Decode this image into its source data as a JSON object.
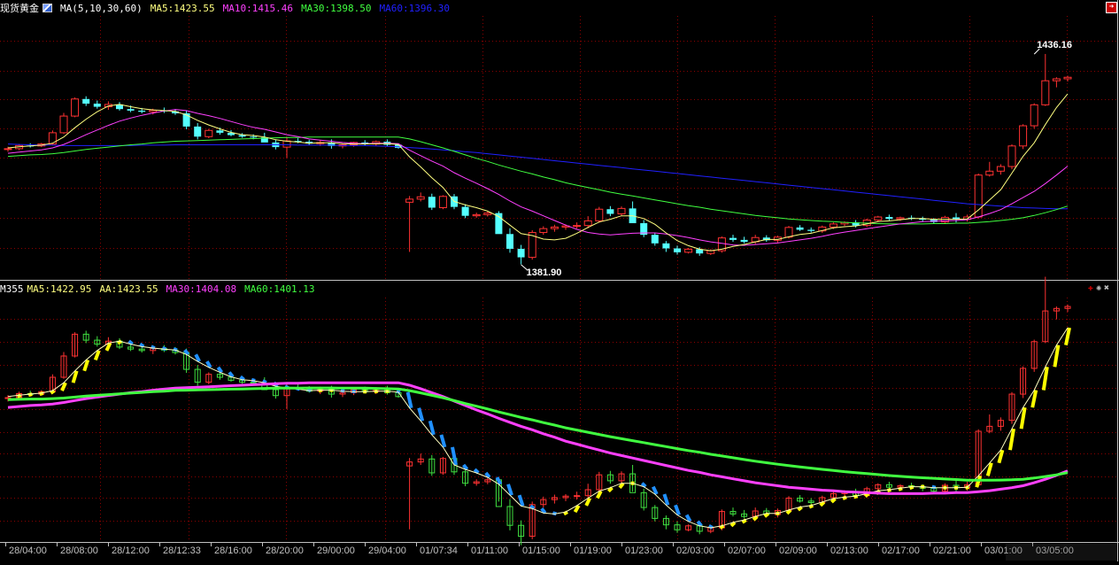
{
  "header_main": {
    "symbol": "现货黄金",
    "ma_label": "MA(5,10,30,60)",
    "ma5": "MA5:1423.55",
    "ma10": "MA10:1415.46",
    "ma30": "MA30:1398.50",
    "ma60": "MA60:1396.30"
  },
  "header_sub": {
    "name": "M355",
    "ma5": "MA5:1422.95",
    "aa": "AA:1423.55",
    "ma30": "MA30:1404.08",
    "ma60": "MA60:1401.13"
  },
  "colors": {
    "background": "#000000",
    "up": "#ff3232",
    "down": "#54ffff",
    "ma5": "#ffff80",
    "ma10": "#ff40ff",
    "ma30": "#40ff40",
    "ma60": "#2020ff",
    "grid": "#8b0000",
    "axis_text": "#c0c0c0",
    "sub_up": "#ff3232",
    "sub_down": "#40e040",
    "sub_bar": "#ffff00",
    "sub_bar_down": "#2090ff",
    "sub_ma30": "#ff40ff",
    "sub_ma60": "#40ff40"
  },
  "chart_data": [
    {
      "type": "candlestick",
      "panel": "main",
      "y_range": [
        1378,
        1446
      ],
      "annotations": [
        {
          "text": "1436.16",
          "candle": 92,
          "value": 1436.16,
          "kind": "high"
        },
        {
          "text": "1381.90",
          "candle": 46,
          "value": 1381.9,
          "kind": "low"
        }
      ],
      "ohlc": [
        [
          1411.6,
          1412.3,
          1411.0,
          1411.8
        ],
        [
          1411.8,
          1413.0,
          1411.4,
          1412.6
        ],
        [
          1412.6,
          1413.2,
          1412.1,
          1412.5
        ],
        [
          1412.5,
          1413.3,
          1412.2,
          1413.0
        ],
        [
          1413.0,
          1416.5,
          1412.7,
          1415.9
        ],
        [
          1415.9,
          1421.0,
          1415.6,
          1420.2
        ],
        [
          1420.2,
          1425.0,
          1419.9,
          1424.6
        ],
        [
          1424.6,
          1425.3,
          1422.8,
          1423.4
        ],
        [
          1423.4,
          1424.2,
          1422.1,
          1422.6
        ],
        [
          1422.6,
          1424.0,
          1421.8,
          1423.2
        ],
        [
          1423.2,
          1423.8,
          1421.6,
          1422.0
        ],
        [
          1422.0,
          1422.9,
          1421.2,
          1421.6
        ],
        [
          1421.6,
          1422.3,
          1420.9,
          1421.3
        ],
        [
          1421.3,
          1422.1,
          1420.6,
          1421.7
        ],
        [
          1421.7,
          1422.4,
          1421.0,
          1421.4
        ],
        [
          1421.4,
          1422.0,
          1420.5,
          1420.9
        ],
        [
          1420.9,
          1421.7,
          1416.8,
          1417.5
        ],
        [
          1417.5,
          1418.4,
          1414.2,
          1414.9
        ],
        [
          1414.9,
          1416.9,
          1414.5,
          1416.5
        ],
        [
          1416.5,
          1417.2,
          1415.4,
          1415.9
        ],
        [
          1415.9,
          1416.6,
          1415.0,
          1415.3
        ],
        [
          1415.3,
          1415.8,
          1414.6,
          1414.9
        ],
        [
          1414.9,
          1415.5,
          1414.2,
          1414.7
        ],
        [
          1414.7,
          1415.9,
          1414.3,
          1413.4
        ],
        [
          1413.4,
          1414.2,
          1411.6,
          1412.2
        ],
        [
          1412.2,
          1414.6,
          1409.5,
          1413.8
        ],
        [
          1413.8,
          1414.5,
          1413.2,
          1413.6
        ],
        [
          1413.6,
          1414.1,
          1412.8,
          1413.1
        ],
        [
          1413.1,
          1414.0,
          1412.5,
          1413.4
        ],
        [
          1413.4,
          1414.2,
          1411.8,
          1412.5
        ],
        [
          1412.5,
          1413.1,
          1411.9,
          1412.8
        ],
        [
          1412.8,
          1413.6,
          1412.3,
          1413.4
        ],
        [
          1413.4,
          1414.0,
          1412.6,
          1413.0
        ],
        [
          1413.0,
          1413.9,
          1412.5,
          1413.6
        ],
        [
          1413.6,
          1414.2,
          1412.4,
          1412.8
        ],
        [
          1412.8,
          1413.0,
          1411.8,
          1412.0
        ],
        [
          1398.0,
          1399.6,
          1385.2,
          1398.8
        ],
        [
          1398.8,
          1400.5,
          1398.2,
          1399.4
        ],
        [
          1399.4,
          1400.2,
          1396.0,
          1396.6
        ],
        [
          1396.6,
          1399.8,
          1396.2,
          1399.5
        ],
        [
          1399.5,
          1400.1,
          1396.2,
          1396.8
        ],
        [
          1396.8,
          1397.5,
          1393.9,
          1394.5
        ],
        [
          1394.5,
          1395.3,
          1394.0,
          1394.8
        ],
        [
          1394.8,
          1395.6,
          1394.3,
          1395.2
        ],
        [
          1395.2,
          1395.7,
          1390.8,
          1389.8
        ],
        [
          1389.8,
          1391.3,
          1385.0,
          1386.0
        ],
        [
          1386.0,
          1387.0,
          1382.0,
          1383.8
        ],
        [
          1383.8,
          1390.8,
          1383.2,
          1390.2
        ],
        [
          1390.2,
          1391.8,
          1389.6,
          1391.2
        ],
        [
          1391.2,
          1392.2,
          1390.4,
          1391.6
        ],
        [
          1391.6,
          1392.3,
          1390.9,
          1391.9
        ],
        [
          1391.9,
          1392.8,
          1391.2,
          1392.0
        ],
        [
          1392.0,
          1394.4,
          1391.3,
          1393.2
        ],
        [
          1393.2,
          1396.8,
          1392.7,
          1396.2
        ],
        [
          1396.2,
          1397.0,
          1394.4,
          1395.0
        ],
        [
          1395.0,
          1396.9,
          1394.5,
          1396.4
        ],
        [
          1396.4,
          1398.2,
          1392.8,
          1392.6
        ],
        [
          1392.6,
          1393.4,
          1389.0,
          1389.6
        ],
        [
          1389.6,
          1390.1,
          1386.8,
          1387.4
        ],
        [
          1387.4,
          1388.0,
          1385.2,
          1386.1
        ],
        [
          1386.1,
          1386.8,
          1384.5,
          1385.1
        ],
        [
          1385.1,
          1386.2,
          1384.8,
          1385.9
        ],
        [
          1385.9,
          1386.4,
          1384.2,
          1384.8
        ],
        [
          1384.8,
          1385.9,
          1384.4,
          1385.5
        ],
        [
          1385.5,
          1389.2,
          1385.0,
          1388.8
        ],
        [
          1388.8,
          1389.6,
          1387.8,
          1388.3
        ],
        [
          1388.3,
          1389.1,
          1387.4,
          1387.8
        ],
        [
          1387.8,
          1389.6,
          1387.2,
          1388.9
        ],
        [
          1388.9,
          1389.5,
          1387.8,
          1388.2
        ],
        [
          1388.2,
          1389.4,
          1387.6,
          1389.0
        ],
        [
          1389.0,
          1391.9,
          1388.6,
          1391.5
        ],
        [
          1391.5,
          1392.1,
          1390.6,
          1390.9
        ],
        [
          1390.9,
          1391.5,
          1390.2,
          1390.6
        ],
        [
          1390.6,
          1392.0,
          1390.1,
          1391.6
        ],
        [
          1391.6,
          1392.8,
          1391.1,
          1392.4
        ],
        [
          1392.4,
          1393.1,
          1391.9,
          1392.8
        ],
        [
          1392.8,
          1393.4,
          1391.5,
          1392.0
        ],
        [
          1392.0,
          1393.8,
          1391.6,
          1393.4
        ],
        [
          1393.4,
          1394.5,
          1393.0,
          1394.2
        ],
        [
          1394.2,
          1394.8,
          1393.3,
          1393.7
        ],
        [
          1393.7,
          1394.3,
          1393.2,
          1394.0
        ],
        [
          1394.0,
          1394.6,
          1393.4,
          1393.8
        ],
        [
          1393.8,
          1394.3,
          1392.9,
          1393.5
        ],
        [
          1393.5,
          1393.9,
          1392.5,
          1392.9
        ],
        [
          1392.9,
          1394.5,
          1392.4,
          1394.1
        ],
        [
          1394.1,
          1395.2,
          1392.8,
          1393.6
        ],
        [
          1393.6,
          1394.8,
          1393.0,
          1394.2
        ],
        [
          1394.2,
          1405.4,
          1393.8,
          1405.0
        ],
        [
          1405.0,
          1408.4,
          1404.6,
          1406.0
        ],
        [
          1406.0,
          1407.8,
          1405.1,
          1407.2
        ],
        [
          1407.2,
          1412.9,
          1406.5,
          1412.5
        ],
        [
          1412.5,
          1418.1,
          1411.7,
          1417.7
        ],
        [
          1417.7,
          1423.5,
          1417.0,
          1423.1
        ],
        [
          1423.1,
          1436.2,
          1422.8,
          1429.3
        ],
        [
          1429.3,
          1430.2,
          1427.6,
          1429.8
        ],
        [
          1429.8,
          1430.6,
          1429.1,
          1430.2
        ]
      ],
      "ma5": [
        1412.0,
        1412.3,
        1412.5,
        1412.7,
        1413.2,
        1414.8,
        1417.2,
        1419.4,
        1421.3,
        1422.8,
        1423.2,
        1422.6,
        1422.1,
        1421.8,
        1421.6,
        1421.4,
        1420.5,
        1419.1,
        1417.9,
        1416.9,
        1416.0,
        1415.4,
        1415.2,
        1414.8,
        1414.1,
        1413.7,
        1413.5,
        1413.2,
        1413.3,
        1413.3,
        1413.1,
        1413.0,
        1413.0,
        1413.1,
        1413.1,
        1412.9,
        1409.7,
        1407.1,
        1404.3,
        1401.8,
        1398.2,
        1397.3,
        1396.6,
        1395.7,
        1394.3,
        1392.1,
        1389.9,
        1389.4,
        1388.5,
        1388.3,
        1388.7,
        1390.0,
        1391.5,
        1392.9,
        1393.6,
        1394.5,
        1394.5,
        1393.8,
        1392.3,
        1390.1,
        1388.1,
        1386.8,
        1385.9,
        1385.5,
        1385.9,
        1386.6,
        1387.1,
        1387.8,
        1388.4,
        1388.4,
        1389.1,
        1389.7,
        1390.0,
        1390.7,
        1391.4,
        1391.7,
        1391.9,
        1392.4,
        1393.0,
        1393.2,
        1393.5,
        1393.8,
        1393.8,
        1393.6,
        1393.6,
        1393.6,
        1393.7,
        1396.0,
        1398.6,
        1401.2,
        1405.5,
        1409.8,
        1413.3,
        1418.0,
        1422.4,
        1425.9
      ],
      "ma10": [
        1410.6,
        1410.9,
        1411.2,
        1411.5,
        1412.0,
        1412.9,
        1414.1,
        1415.4,
        1416.6,
        1417.8,
        1418.9,
        1419.7,
        1420.4,
        1421.0,
        1421.5,
        1421.9,
        1421.6,
        1420.9,
        1420.3,
        1419.6,
        1418.8,
        1418.0,
        1417.3,
        1416.8,
        1416.1,
        1415.4,
        1414.9,
        1414.3,
        1414.0,
        1413.7,
        1413.4,
        1413.2,
        1413.1,
        1413.2,
        1413.2,
        1413.1,
        1411.4,
        1410.0,
        1408.6,
        1407.3,
        1405.6,
        1404.2,
        1402.9,
        1401.5,
        1400.0,
        1398.3,
        1396.8,
        1395.7,
        1394.5,
        1393.3,
        1392.1,
        1391.0,
        1390.2,
        1389.8,
        1389.6,
        1389.8,
        1390.0,
        1390.1,
        1390.1,
        1389.8,
        1389.4,
        1388.9,
        1388.3,
        1387.8,
        1387.4,
        1387.0,
        1386.9,
        1387.1,
        1387.3,
        1387.5,
        1387.9,
        1388.3,
        1388.7,
        1389.2,
        1389.8,
        1390.3,
        1390.7,
        1391.2,
        1391.6,
        1392.0,
        1392.4,
        1392.7,
        1393.0,
        1393.1,
        1393.2,
        1393.3,
        1393.5,
        1394.2,
        1395.1,
        1396.1,
        1397.6,
        1399.2,
        1400.8,
        1402.8,
        1405.0,
        1407.3
      ],
      "ma30": [
        1409.8,
        1410.0,
        1410.2,
        1410.3,
        1410.5,
        1410.8,
        1411.2,
        1411.6,
        1411.9,
        1412.2,
        1412.5,
        1412.8,
        1413.0,
        1413.3,
        1413.5,
        1413.7,
        1413.8,
        1413.9,
        1414.0,
        1414.1,
        1414.2,
        1414.3,
        1414.4,
        1414.5,
        1414.6,
        1414.7,
        1414.7,
        1414.8,
        1414.8,
        1414.8,
        1414.8,
        1414.8,
        1414.8,
        1414.8,
        1414.8,
        1414.8,
        1414.3,
        1413.6,
        1412.8,
        1412.0,
        1411.1,
        1410.2,
        1409.3,
        1408.5,
        1407.6,
        1406.8,
        1406.0,
        1405.3,
        1404.5,
        1403.8,
        1403.0,
        1402.4,
        1401.8,
        1401.2,
        1400.6,
        1400.1,
        1399.6,
        1399.1,
        1398.6,
        1398.1,
        1397.6,
        1397.1,
        1396.7,
        1396.2,
        1395.8,
        1395.4,
        1395.0,
        1394.6,
        1394.3,
        1394.0,
        1393.7,
        1393.5,
        1393.3,
        1393.1,
        1393.0,
        1392.8,
        1392.7,
        1392.6,
        1392.5,
        1392.4,
        1392.4,
        1392.4,
        1392.4,
        1392.5,
        1392.5,
        1392.6,
        1392.6,
        1392.8,
        1393.0,
        1393.3,
        1393.6,
        1394.0,
        1394.6,
        1395.3,
        1396.1,
        1397.0
      ],
      "ma60": [
        1413.0,
        1412.9,
        1412.8,
        1412.7,
        1412.7,
        1412.6,
        1412.6,
        1412.6,
        1412.6,
        1412.6,
        1412.6,
        1412.6,
        1412.7,
        1412.7,
        1412.7,
        1412.8,
        1412.8,
        1412.8,
        1412.8,
        1412.8,
        1412.8,
        1412.8,
        1412.8,
        1412.8,
        1412.8,
        1412.8,
        1412.7,
        1412.7,
        1412.7,
        1412.7,
        1412.6,
        1412.6,
        1412.6,
        1412.5,
        1412.4,
        1412.3,
        1412.1,
        1411.9,
        1411.7,
        1411.5,
        1411.3,
        1411.0,
        1410.8,
        1410.5,
        1410.2,
        1409.9,
        1409.6,
        1409.3,
        1409.0,
        1408.7,
        1408.4,
        1408.1,
        1407.8,
        1407.5,
        1407.2,
        1406.9,
        1406.6,
        1406.3,
        1406.0,
        1405.7,
        1405.4,
        1405.1,
        1404.8,
        1404.5,
        1404.2,
        1403.9,
        1403.6,
        1403.3,
        1403.0,
        1402.7,
        1402.4,
        1402.1,
        1401.8,
        1401.5,
        1401.2,
        1400.9,
        1400.6,
        1400.3,
        1400.0,
        1399.7,
        1399.4,
        1399.1,
        1398.8,
        1398.5,
        1398.2,
        1397.9,
        1397.6,
        1397.4,
        1397.2,
        1397.0,
        1396.8,
        1396.6,
        1396.5,
        1396.4,
        1396.3,
        1396.3
      ]
    },
    {
      "type": "candlestick",
      "panel": "sub",
      "time_labels": [
        "28/04:00",
        "28/08:00",
        "28/12:00",
        "28/12:33",
        "28/16:00",
        "28/20:00",
        "29/00:00",
        "29/04:00",
        "01/07:34",
        "01/11:00",
        "01/15:00",
        "01/19:00",
        "01/23:00",
        "02/03:00",
        "02/07:00",
        "02/09:00",
        "02/13:00",
        "02/17:00",
        "02/21:00",
        "03/01:00",
        "03/05:00"
      ]
    }
  ]
}
